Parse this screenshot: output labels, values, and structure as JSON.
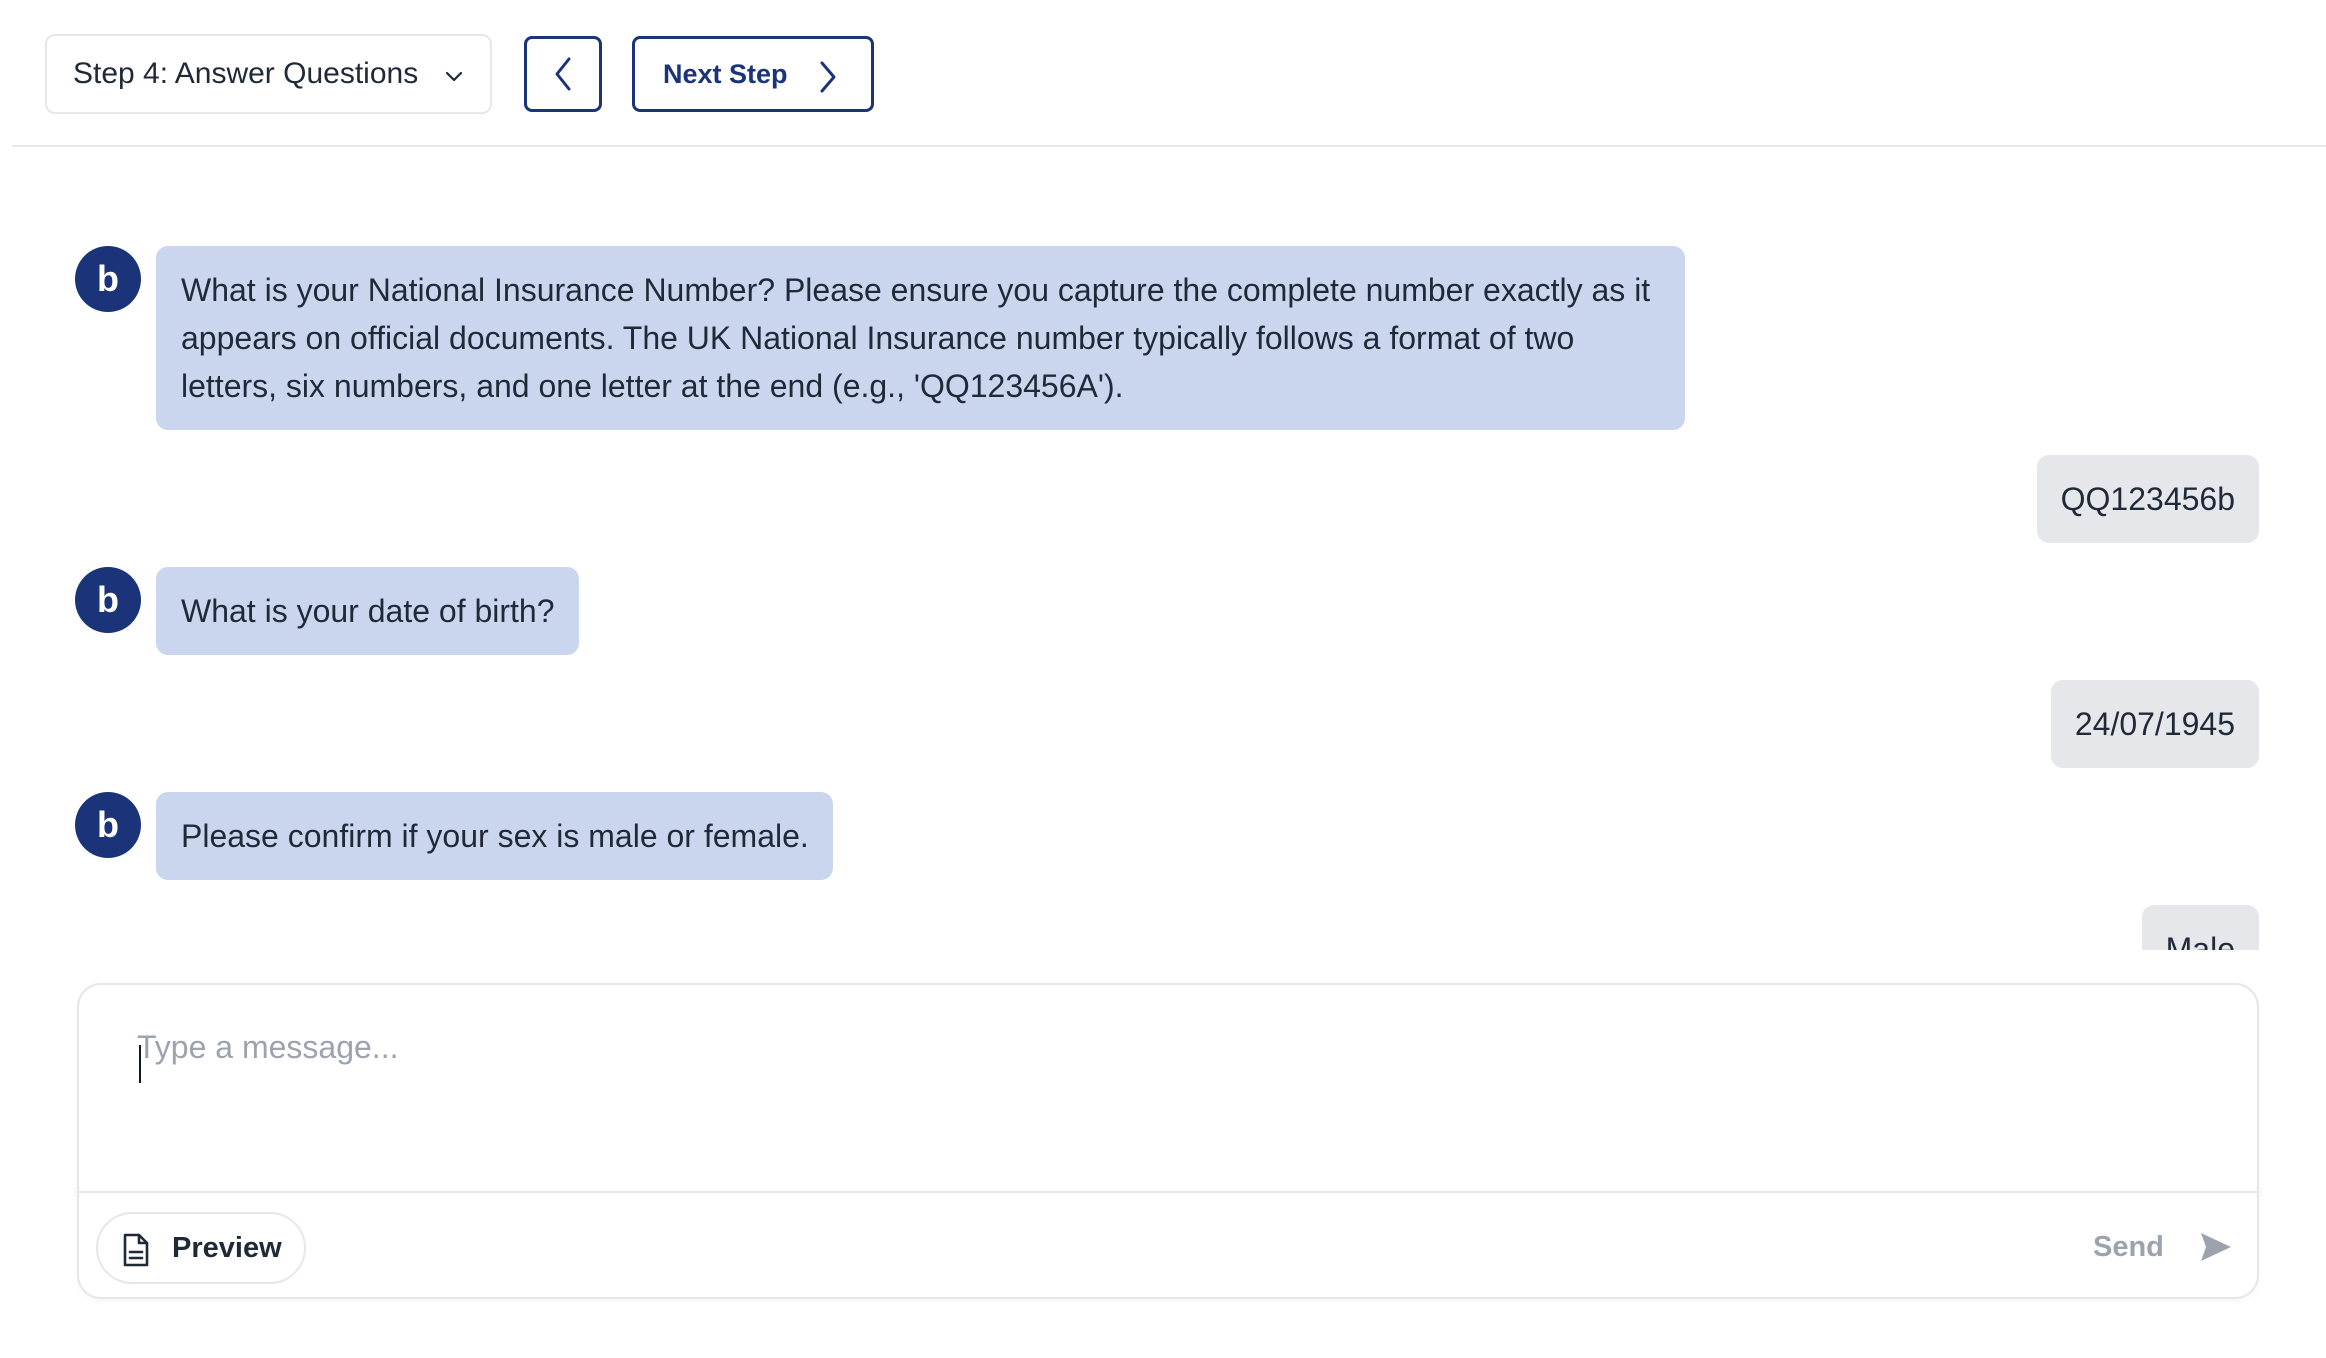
{
  "toolbar": {
    "step_select": "Step 4: Answer Questions",
    "next_label": "Next Step"
  },
  "chat": {
    "avatar_letter": "b",
    "messages": [
      {
        "from": "bot",
        "text": "What is your National Insurance Number? Please ensure you capture the complete number exactly as it appears on official documents. The UK National Insurance number typically follows a format of two letters, six numbers, and one letter at the end (e.g., 'QQ123456A')."
      },
      {
        "from": "user",
        "text": "QQ123456b"
      },
      {
        "from": "bot",
        "text": "What is your date of birth?"
      },
      {
        "from": "user",
        "text": "24/07/1945"
      },
      {
        "from": "bot",
        "text": "Please confirm if your sex is male or female."
      },
      {
        "from": "user",
        "text": "Male"
      }
    ]
  },
  "composer": {
    "placeholder": "Type a message...",
    "value": "",
    "preview_label": "Preview",
    "send_label": "Send"
  },
  "colors": {
    "brand": "#1b3479",
    "bot_bubble": "#c9d6ee",
    "user_bubble": "#e5e7eb",
    "muted": "#9ca3af"
  }
}
